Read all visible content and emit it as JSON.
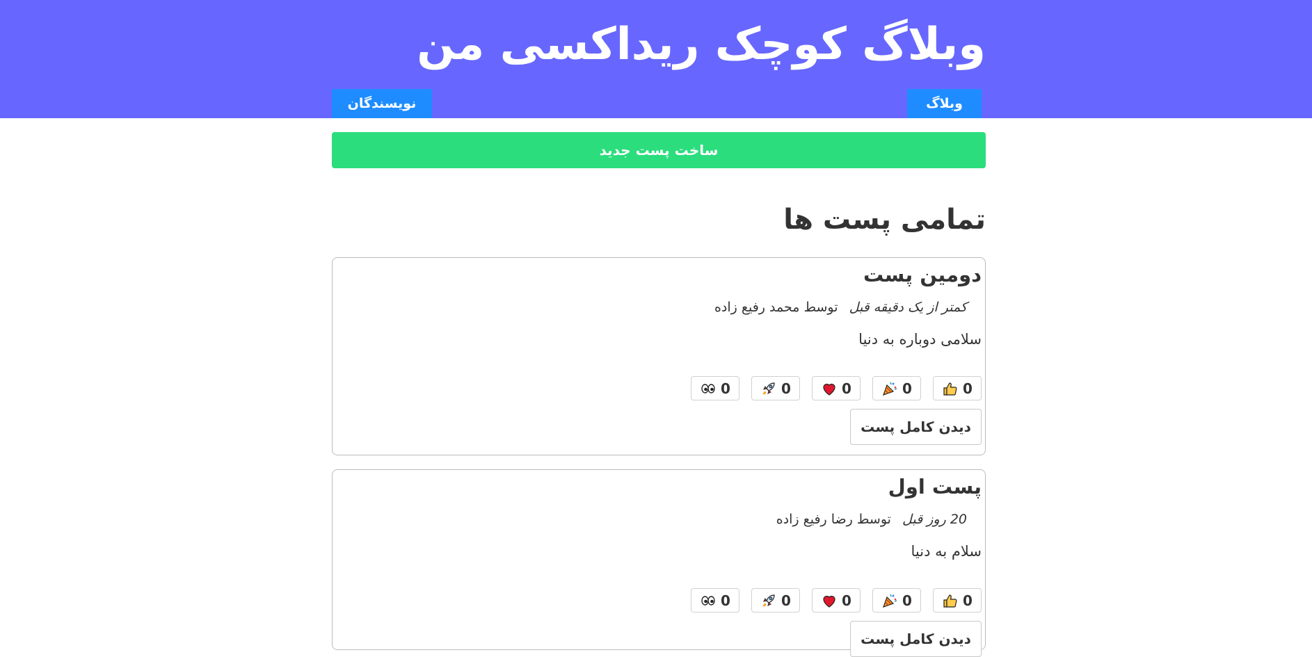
{
  "header": {
    "title": "وبلاگ کوچک ریداکسی من",
    "nav_blog": "وبلاگ",
    "nav_authors": "نویسندگان"
  },
  "create_post_label": "ساخت پست جدید",
  "section_title": "تمامی پست ها",
  "posts": [
    {
      "title": "دومین پست",
      "time": "کمتر از یک دقیقه قبل",
      "author": "توسط محمد رفیع زاده",
      "body": "سلامی دوباره به دنیا",
      "reactions": [
        {
          "icon": "thumbs-up-icon",
          "count": "0"
        },
        {
          "icon": "party-popper-icon",
          "count": "0"
        },
        {
          "icon": "heart-icon",
          "count": "0"
        },
        {
          "icon": "rocket-icon",
          "count": "0"
        },
        {
          "icon": "eyes-icon",
          "count": "0"
        }
      ],
      "view_label": "دیدن کامل پست"
    },
    {
      "title": "پست اول",
      "time": "20 روز قبل",
      "author": "توسط رضا رفیع زاده",
      "body": "سلام به دنیا",
      "reactions": [
        {
          "icon": "thumbs-up-icon",
          "count": "0"
        },
        {
          "icon": "party-popper-icon",
          "count": "0"
        },
        {
          "icon": "heart-icon",
          "count": "0"
        },
        {
          "icon": "rocket-icon",
          "count": "0"
        },
        {
          "icon": "eyes-icon",
          "count": "0"
        }
      ],
      "view_label": "دیدن کامل پست"
    }
  ],
  "colors": {
    "header_bg": "#6767ff",
    "nav_button": "#1e8cff",
    "create_button": "#2bdd7d"
  }
}
